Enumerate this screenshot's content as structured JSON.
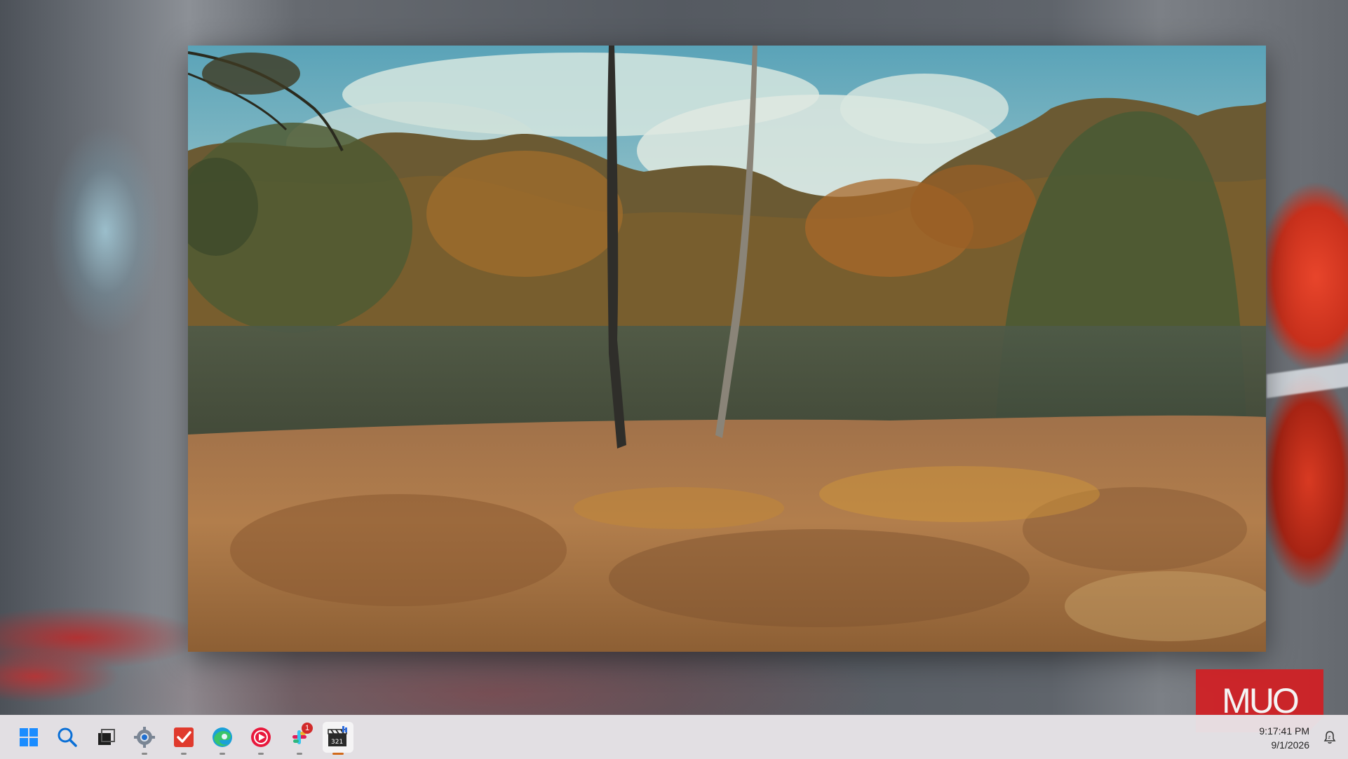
{
  "wallpaper": {
    "description_icon": "blurred-autumn-leaf-wallpaper"
  },
  "viewer": {
    "image_icon": "autumn-heathland-forest-photo"
  },
  "watermark": {
    "text": "MUO"
  },
  "taskbar": {
    "items": [
      {
        "name": "start",
        "icon": "windows-logo-icon"
      },
      {
        "name": "search",
        "icon": "search-icon"
      },
      {
        "name": "task-view",
        "icon": "task-view-icon"
      },
      {
        "name": "settings",
        "icon": "gear-icon"
      },
      {
        "name": "todoist",
        "icon": "checkmark-app-icon"
      },
      {
        "name": "edge",
        "icon": "edge-browser-icon"
      },
      {
        "name": "media-player",
        "icon": "play-icon"
      },
      {
        "name": "slack",
        "icon": "slack-icon",
        "badge": "1"
      },
      {
        "name": "video-editor",
        "icon": "clapperboard-icon"
      }
    ],
    "clock": {
      "time": "9:17:41 PM",
      "date": "9/1/2026"
    },
    "notifications": {
      "icon": "notification-bell-icon"
    }
  },
  "colors": {
    "accent": "#d16a1a",
    "watermark_red": "#d21e23",
    "taskbar_bg": "#e8e4e8"
  }
}
